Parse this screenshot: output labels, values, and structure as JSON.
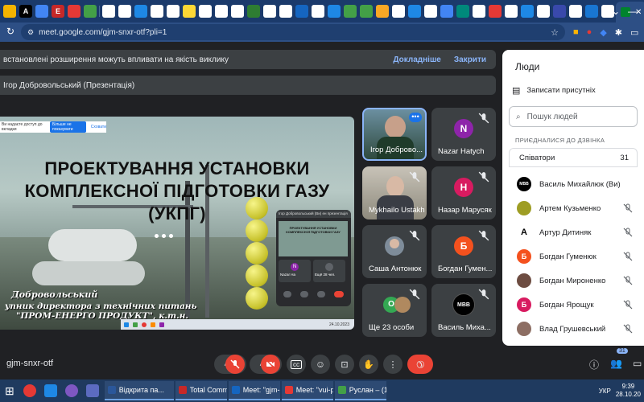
{
  "browser": {
    "tab_icons": [
      "A",
      "E",
      "E",
      "Z",
      "M",
      "A"
    ],
    "url": "meet.google.com/gjm-snxr-otf?pli=1",
    "win_minimize": "—",
    "win_close": "+"
  },
  "banner": {
    "text": "встановлені розширення можуть впливати на якість виклику",
    "details": "Докладніше",
    "close": "Закрити"
  },
  "presentation": {
    "label": "Ігор Добровольський (Презентація)"
  },
  "slide": {
    "title_line1": "ПРОЕКТУВАННЯ УСТАНОВКИ",
    "title_line2": "КОМПЛЕКСНОЇ ПІДГОТОВКИ ГАЗУ",
    "title_line3": "(УКПГ)",
    "presenter_name": "Добровольський",
    "presenter_role": "упник директора з технічних питань",
    "presenter_company": "\"ПРОМ-ЕНЕРГО ПРОДУКТ\", к.т.н.",
    "share_banner": "Ви надаєте доступ до вкладки",
    "share_stop": "Більше не показувати",
    "share_hide": "Сховати",
    "taskbar_time": "24.10.2023"
  },
  "mini_window": {
    "header": "Ігор Добровольський (Ви) ен презентація",
    "tile1": "Nazar Ha",
    "tile2": "Ещё 28 чел."
  },
  "tiles": [
    {
      "name": "Ігор Доброво...",
      "type": "video1"
    },
    {
      "name": "Nazar Hatych",
      "initial": "N",
      "color": "#8e24aa"
    },
    {
      "name": "Mykhailo Ustakh",
      "type": "video2"
    },
    {
      "name": "Назар Марусяк",
      "initial": "Н",
      "color": "#d81b60"
    },
    {
      "name": "Саша Антонюк",
      "type": "photo"
    },
    {
      "name": "Богдан Гумен...",
      "initial": "Б",
      "color": "#f4511e"
    },
    {
      "name": "Ще 23 особи",
      "initial": "О",
      "color": "#34a853"
    },
    {
      "name": "Василь Миха...",
      "initial": "MBB",
      "color": "#000000"
    }
  ],
  "panel": {
    "title": "Люди",
    "record": "Записати присутніх",
    "search_placeholder": "Пошук людей",
    "section": "ПРИЄДНАЛИСЯ ДО ДЗВІНКА",
    "group": "Співатори",
    "count": "31",
    "people": [
      {
        "name": "Василь Михайлюк (Ви)",
        "initial": "MBB",
        "color": "#000000"
      },
      {
        "name": "Артем Кузьменко",
        "initial": "",
        "color": "#9e9d24"
      },
      {
        "name": "Артур Дитиняк",
        "initial": "A",
        "color": "#ffffff"
      },
      {
        "name": "Богдан Гуменюк",
        "initial": "Б",
        "color": "#f4511e"
      },
      {
        "name": "Богдан Мироненко",
        "initial": "",
        "color": "#6d4c41"
      },
      {
        "name": "Богдан Ярощук",
        "initial": "Б",
        "color": "#d81b60"
      },
      {
        "name": "Влад Грушевський",
        "initial": "",
        "color": "#8d6e63"
      }
    ]
  },
  "meeting": {
    "code": "gjm-snxr-otf",
    "participants_badge": "31"
  },
  "taskbar": {
    "items": [
      "Відкрита па...",
      "Total Comm...",
      "Meet: \"gjm-...",
      "Meet: \"vui-p...",
      "Руслан – (1..."
    ],
    "lang": "УКР",
    "time": "9:39",
    "date": "28.10.20"
  }
}
